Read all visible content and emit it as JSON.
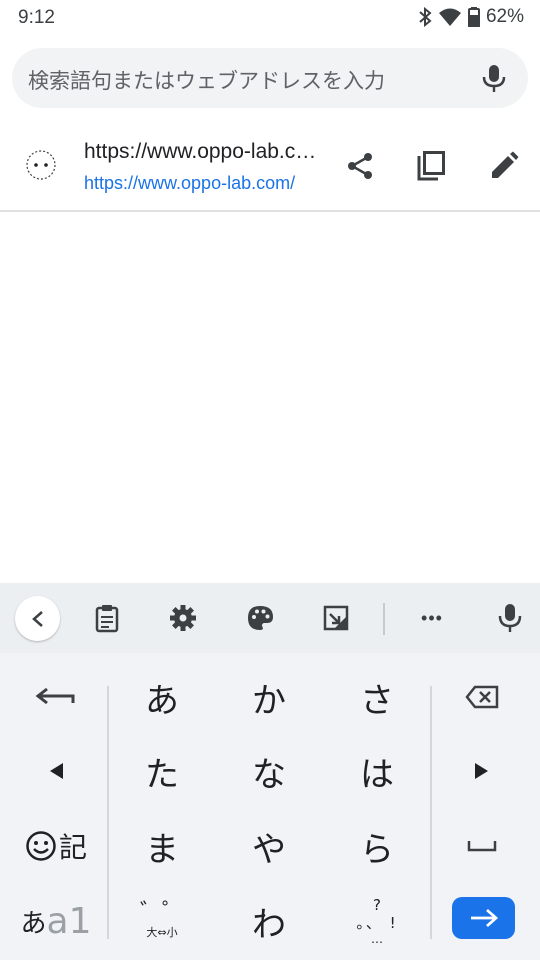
{
  "status_bar": {
    "time": "9:12",
    "battery_percent": "62%",
    "icons": [
      "bluetooth-icon",
      "wifi-icon",
      "battery-icon"
    ]
  },
  "search": {
    "placeholder": "検索語句またはウェブアドレスを入力"
  },
  "suggestion": {
    "title": "https://www.oppo-lab.com/",
    "url": "https://www.oppo-lab.com/",
    "actions": [
      "share-icon",
      "copy-icon",
      "edit-icon"
    ]
  },
  "keyboard": {
    "toolbar_icons": [
      "back-icon",
      "clipboard-icon",
      "settings-icon",
      "palette-icon",
      "resize-icon",
      "more-icon",
      "mic-icon"
    ],
    "more_label": "•••",
    "keys": {
      "row1": [
        "あ",
        "か",
        "さ"
      ],
      "row2": [
        "た",
        "な",
        "は"
      ],
      "row3": [
        "ま",
        "や",
        "ら"
      ],
      "row4_center": "わ"
    },
    "emoji_key_label": "記",
    "mode_key_label_a": "あ",
    "mode_key_label_b": "a1",
    "dakuten_label": "゛゜",
    "dakuten_sub_label": "大⇔小",
    "punct_top": "?",
    "punct_mid": "。、 !",
    "punct_bottom": "…",
    "accent_color": "#1a73e8"
  }
}
